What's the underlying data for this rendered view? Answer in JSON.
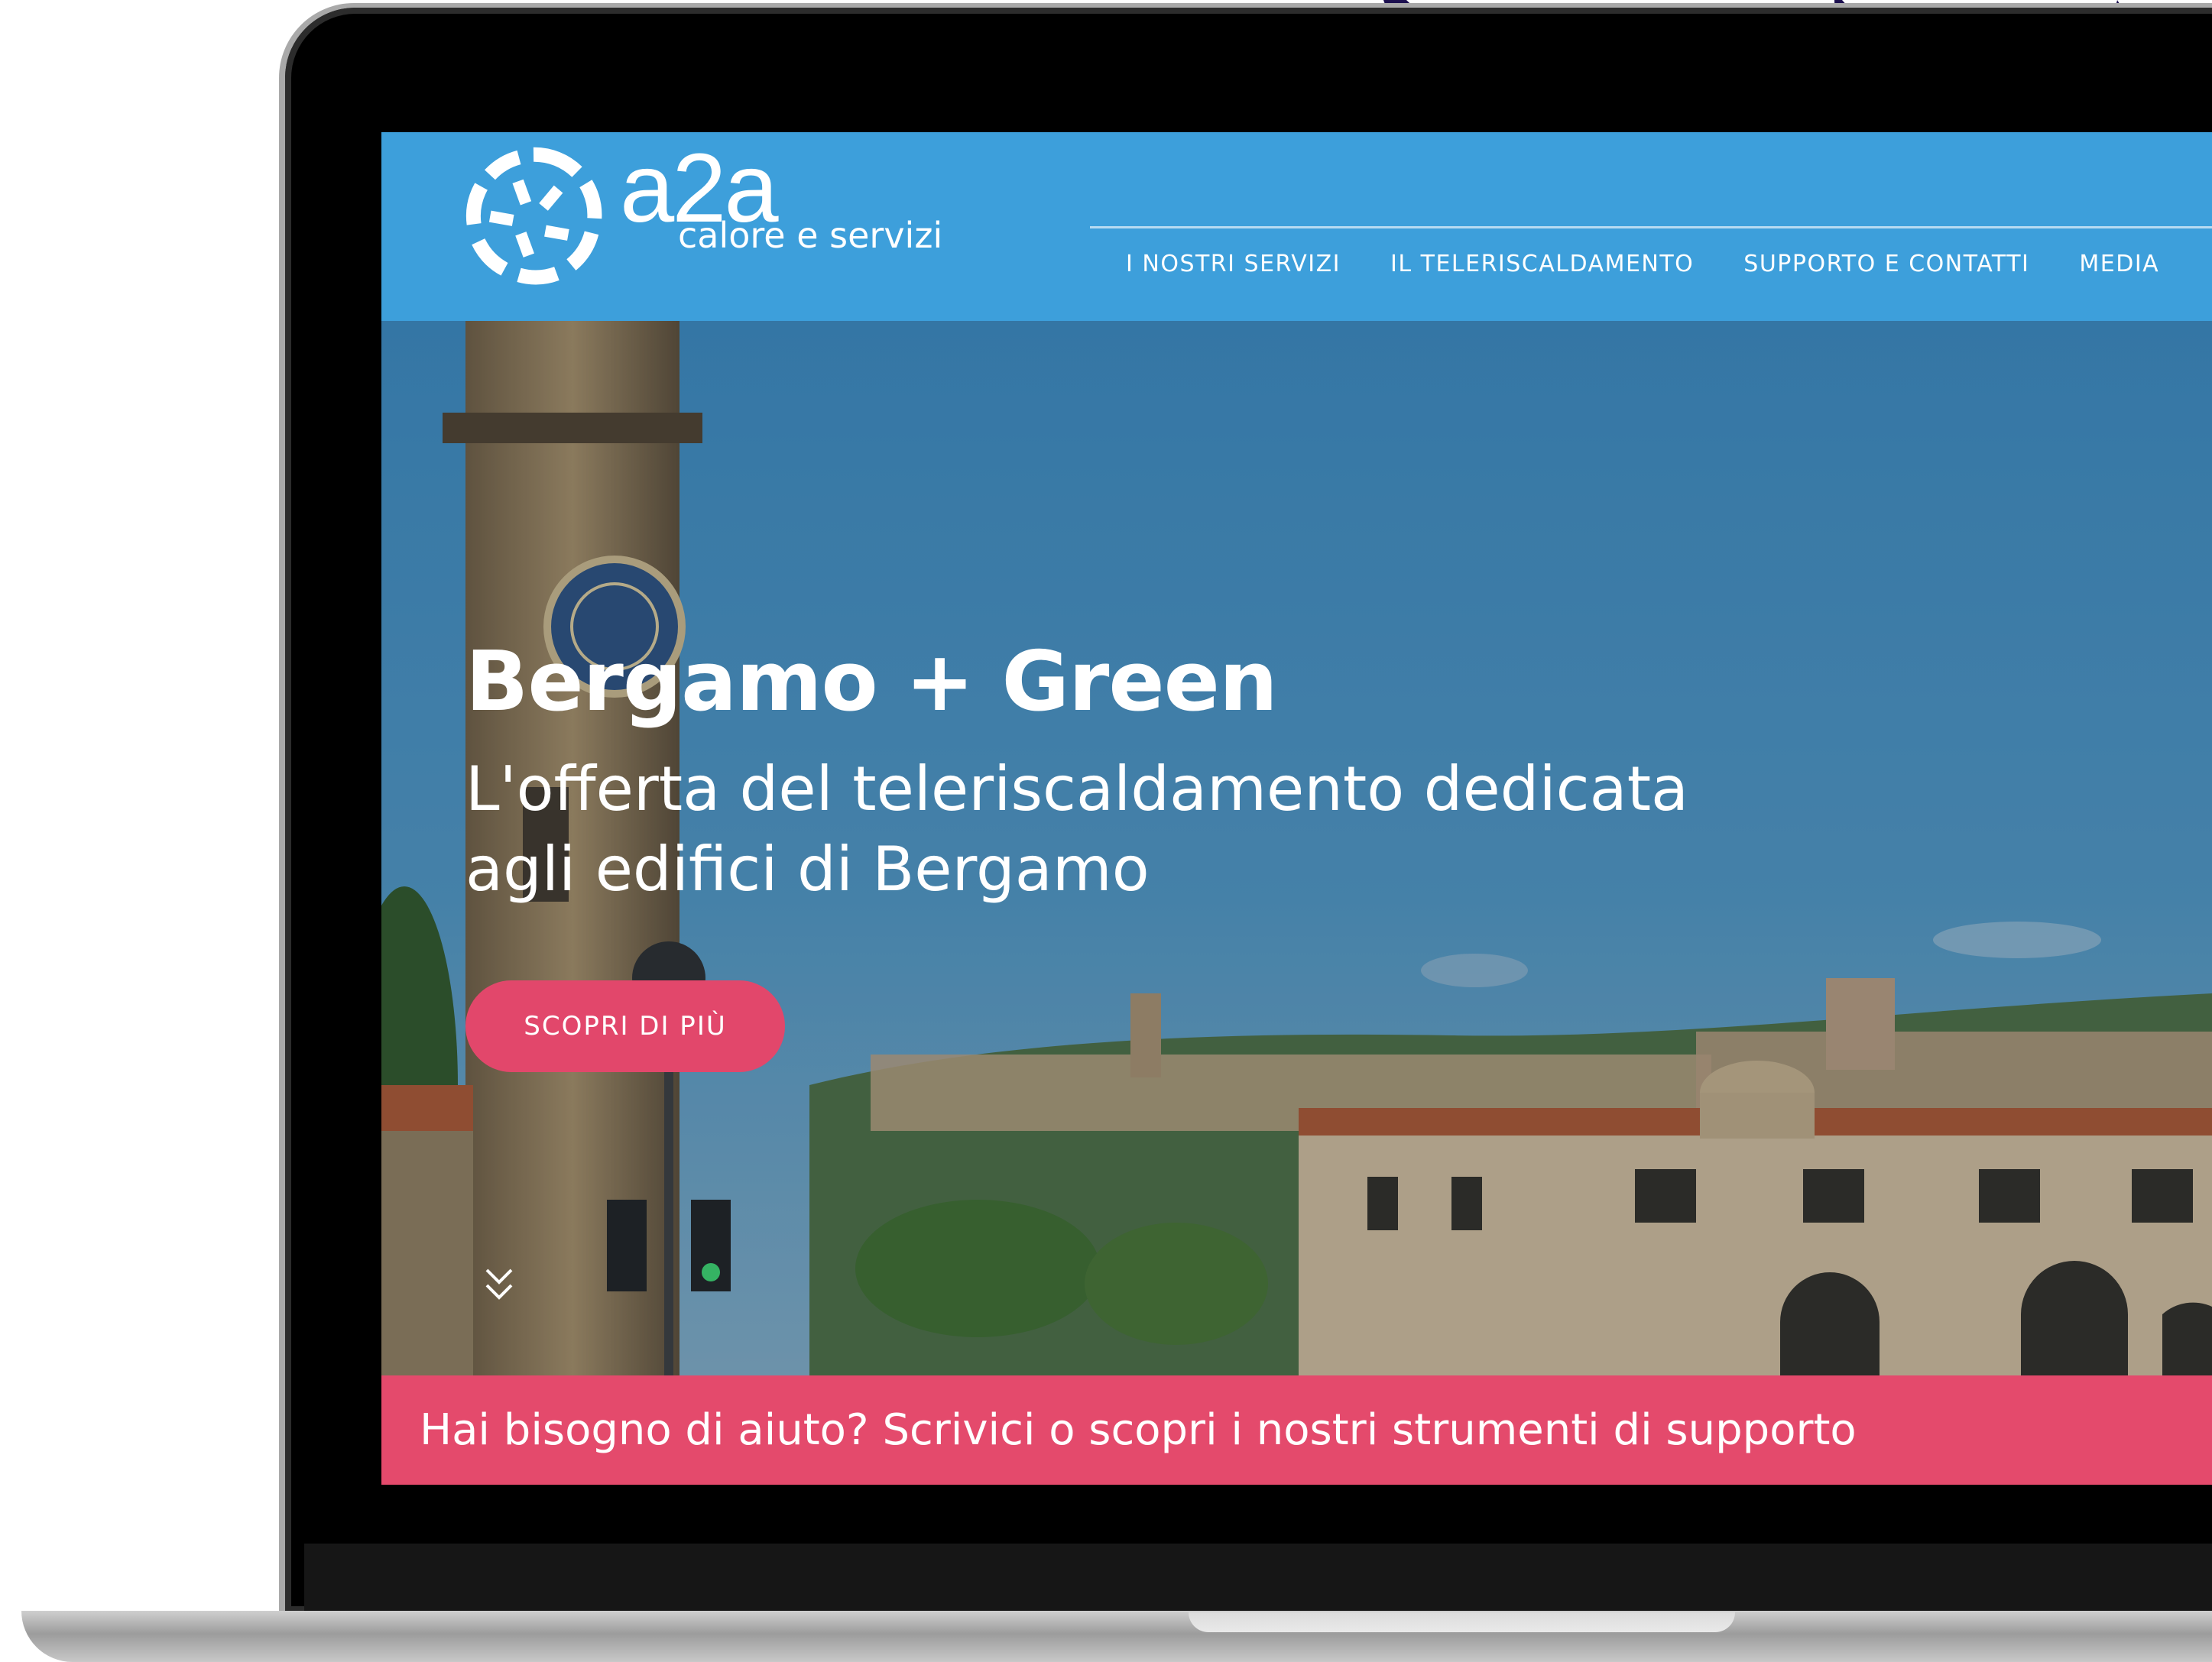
{
  "colors": {
    "brand_blue": "#3d9fdb",
    "accent_pink": "#e2476b",
    "help_bar_pink": "#e44a6c",
    "decor_navy": "#1c0f4f"
  },
  "header": {
    "logo_word": "a2a",
    "logo_tagline": "calore e servizi",
    "nav_items": [
      {
        "label": "I NOSTRI SERVIZI"
      },
      {
        "label": "IL TELERISCALDAMENTO"
      },
      {
        "label": "SUPPORTO E CONTATTI"
      },
      {
        "label": "MEDIA"
      }
    ]
  },
  "hero": {
    "title": "Bergamo + Green",
    "subtitle": "L'offerta del teleriscaldamento dedicata agli edifici di Bergamo",
    "cta_label": "SCOPRI DI PIÙ",
    "scroll_icon": "double-chevron-down-icon"
  },
  "help_bar": {
    "text": "Hai bisogno di aiuto? Scrivici o scopri i nostri strumenti di supporto"
  }
}
